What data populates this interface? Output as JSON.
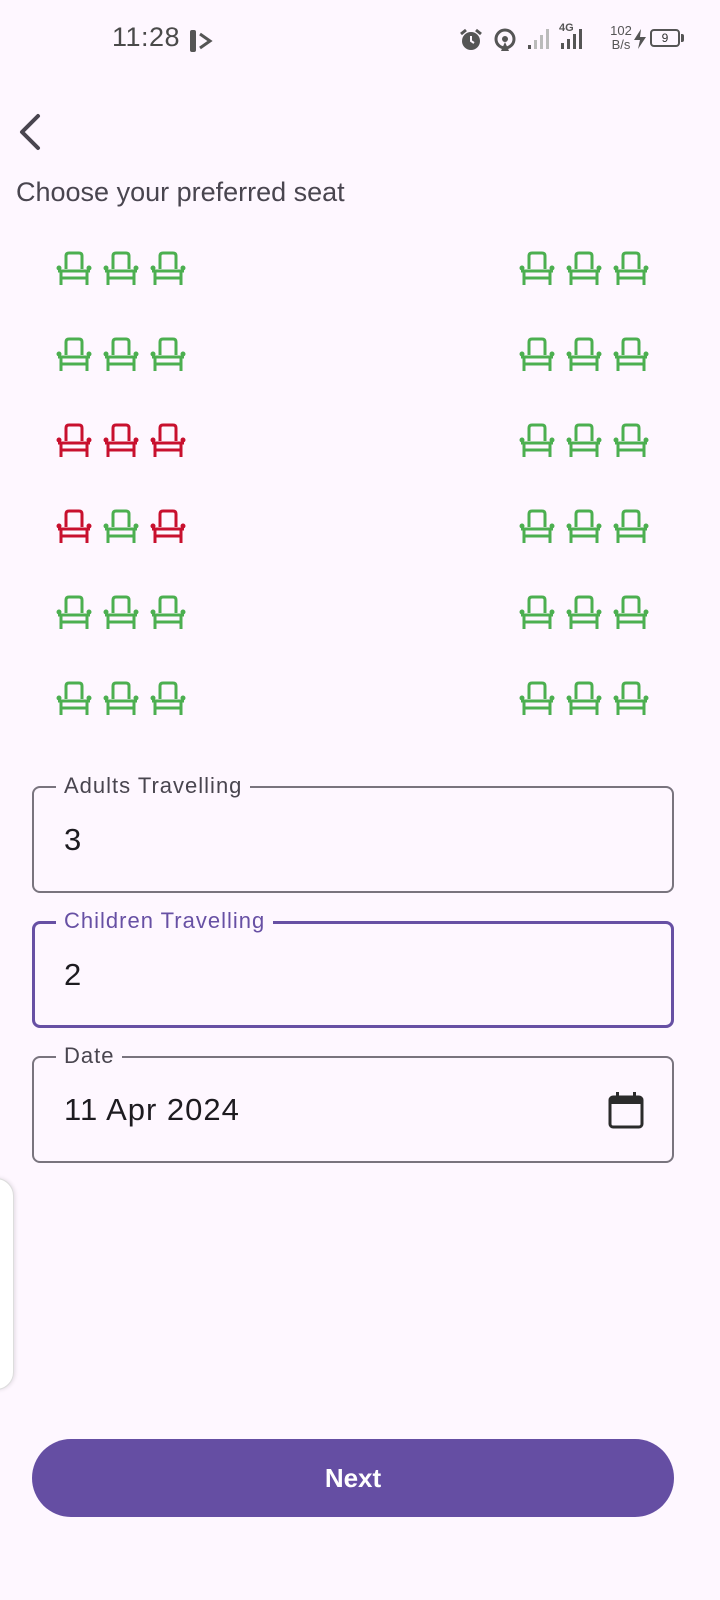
{
  "status_bar": {
    "time": "11:28",
    "net_speed_value": "102",
    "net_speed_unit": "B/s",
    "network_label": "4G",
    "battery_level": "9"
  },
  "header": {
    "back_icon": "chevron-left-icon",
    "title": "Choose your preferred seat"
  },
  "seat_map": {
    "icon": "seat-icon",
    "colors": {
      "available": "#4CAF50",
      "booked": "#C8102E"
    },
    "rows": [
      {
        "left": [
          "available",
          "available",
          "available"
        ],
        "right": [
          "available",
          "available",
          "available"
        ]
      },
      {
        "left": [
          "available",
          "available",
          "available"
        ],
        "right": [
          "available",
          "available",
          "available"
        ]
      },
      {
        "left": [
          "booked",
          "booked",
          "booked"
        ],
        "right": [
          "available",
          "available",
          "available"
        ]
      },
      {
        "left": [
          "booked",
          "available",
          "booked"
        ],
        "right": [
          "available",
          "available",
          "available"
        ]
      },
      {
        "left": [
          "available",
          "available",
          "available"
        ],
        "right": [
          "available",
          "available",
          "available"
        ]
      },
      {
        "left": [
          "available",
          "available",
          "available"
        ],
        "right": [
          "available",
          "available",
          "available"
        ]
      }
    ]
  },
  "form": {
    "adults": {
      "label": "Adults Travelling",
      "value": "3"
    },
    "children": {
      "label": "Children Travelling",
      "value": "2"
    },
    "date": {
      "label": "Date",
      "value": "11 Apr 2024",
      "icon": "calendar-icon"
    }
  },
  "actions": {
    "next_label": "Next"
  },
  "theme": {
    "primary": "#654EA3",
    "background": "#FEF7FF"
  }
}
